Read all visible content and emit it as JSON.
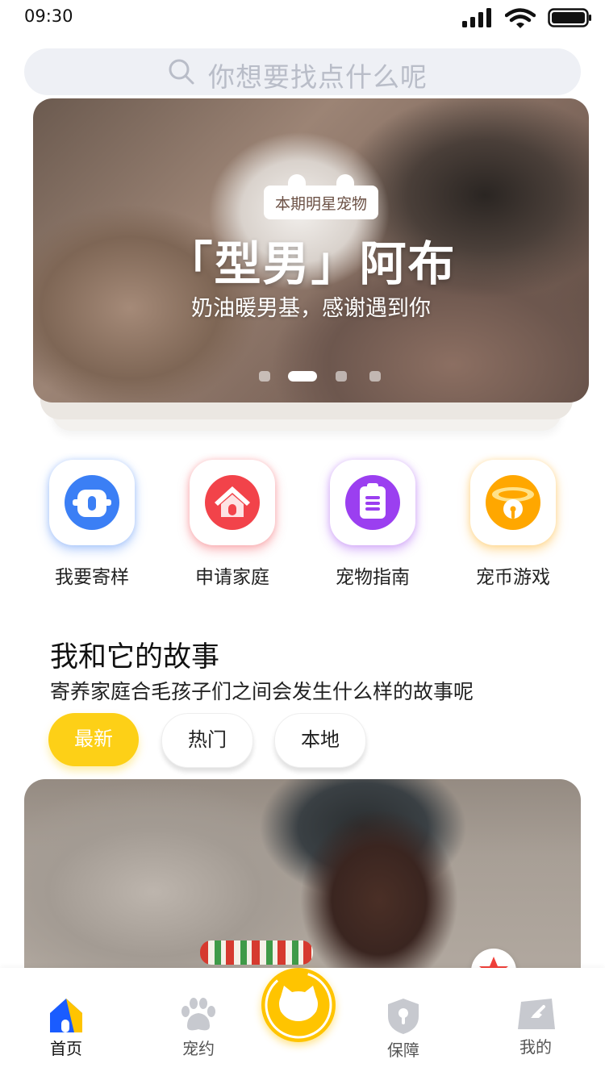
{
  "status_bar": {
    "time": "09:30"
  },
  "search": {
    "placeholder": "你想要找点什么呢"
  },
  "banner": {
    "badge": "本期明星宠物",
    "title": "「型男」阿布",
    "subtitle": "奶油暖男基，感谢遇到你",
    "dots": 4,
    "active_dot": 2
  },
  "features": [
    {
      "label": "我要寄样",
      "icon": "kennel-icon",
      "color": "#3b7ff5"
    },
    {
      "label": "申请家庭",
      "icon": "house-icon",
      "color": "#f2434a"
    },
    {
      "label": "宠物指南",
      "icon": "clipboard-icon",
      "color": "#9b3ff0"
    },
    {
      "label": "宠币游戏",
      "icon": "bell-collar-icon",
      "color": "#ffa700"
    }
  ],
  "story": {
    "title": "我和它的故事",
    "subtitle": "寄养家庭合毛孩子们之间会发生什么样的故事呢",
    "filters": [
      "最新",
      "热门",
      "本地"
    ],
    "active_filter": "最新"
  },
  "tabbar": {
    "items": [
      {
        "label": "首页",
        "icon": "home-icon",
        "active": true
      },
      {
        "label": "宠约",
        "icon": "paw-icon",
        "active": false
      },
      {
        "label": "",
        "icon": "cat-face-icon",
        "active": false
      },
      {
        "label": "保障",
        "icon": "shield-icon",
        "active": false
      },
      {
        "label": "我的",
        "icon": "profile-card-icon",
        "active": false
      }
    ]
  },
  "colors": {
    "accent": "#fdd017",
    "tab_active": "#1a5cff"
  }
}
